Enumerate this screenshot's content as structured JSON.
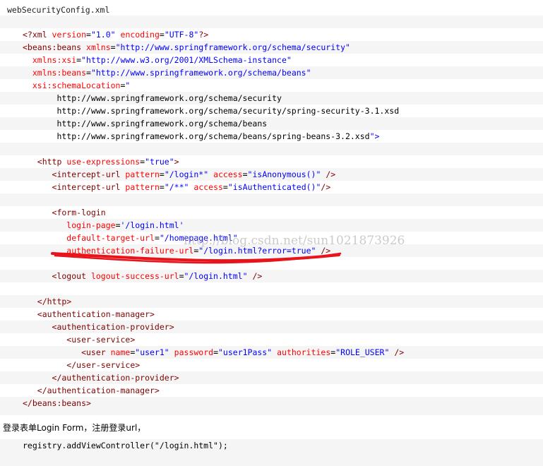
{
  "title": "webSecurityConfig.xml",
  "colors": {
    "tag": "#800000",
    "attr": "#ff0000",
    "value": "#0000ff",
    "text": "#000000",
    "annotation": "#e8141b"
  },
  "code_lines": [
    [],
    [
      {
        "t": "<?xml ",
        "c": "tag"
      },
      {
        "t": "version",
        "c": "attr"
      },
      {
        "t": "=",
        "c": "plain"
      },
      {
        "t": "\"1.0\"",
        "c": "val"
      },
      {
        "t": " ",
        "c": "plain"
      },
      {
        "t": "encoding",
        "c": "attr"
      },
      {
        "t": "=",
        "c": "plain"
      },
      {
        "t": "\"UTF-8\"",
        "c": "val"
      },
      {
        "t": "?>",
        "c": "tag"
      }
    ],
    [
      {
        "t": "<beans:beans ",
        "c": "tag"
      },
      {
        "t": "xmlns",
        "c": "attr"
      },
      {
        "t": "=",
        "c": "plain"
      },
      {
        "t": "\"http://www.springframework.org/schema/security\"",
        "c": "val"
      }
    ],
    [
      {
        "t": "  xmlns:xsi",
        "c": "attr"
      },
      {
        "t": "=",
        "c": "plain"
      },
      {
        "t": "\"http://www.w3.org/2001/XMLSchema-instance\"",
        "c": "val"
      }
    ],
    [
      {
        "t": "  xmlns:beans",
        "c": "attr"
      },
      {
        "t": "=",
        "c": "plain"
      },
      {
        "t": "\"http://www.springframework.org/schema/beans\"",
        "c": "val"
      }
    ],
    [
      {
        "t": "  xsi:schemaLocation",
        "c": "attr"
      },
      {
        "t": "=",
        "c": "plain"
      },
      {
        "t": "\"",
        "c": "val"
      }
    ],
    [
      {
        "t": "       http://www.springframework.org/schema/security",
        "c": "plain"
      }
    ],
    [
      {
        "t": "       http://www.springframework.org/schema/security/spring-security-3.1.xsd",
        "c": "plain"
      }
    ],
    [
      {
        "t": "       http://www.springframework.org/schema/beans",
        "c": "plain"
      }
    ],
    [
      {
        "t": "       http://www.springframework.org/schema/beans/spring-beans-3.2.xsd",
        "c": "plain"
      },
      {
        "t": "\">",
        "c": "val"
      }
    ],
    [],
    [
      {
        "t": "   <http ",
        "c": "tag"
      },
      {
        "t": "use-expressions",
        "c": "attr"
      },
      {
        "t": "=",
        "c": "plain"
      },
      {
        "t": "\"true\"",
        "c": "val"
      },
      {
        "t": ">",
        "c": "tag"
      }
    ],
    [
      {
        "t": "      <intercept-url ",
        "c": "tag"
      },
      {
        "t": "pattern",
        "c": "attr"
      },
      {
        "t": "=",
        "c": "plain"
      },
      {
        "t": "\"/login*\"",
        "c": "val"
      },
      {
        "t": " ",
        "c": "plain"
      },
      {
        "t": "access",
        "c": "attr"
      },
      {
        "t": "=",
        "c": "plain"
      },
      {
        "t": "\"isAnonymous()\"",
        "c": "val"
      },
      {
        "t": " />",
        "c": "tag"
      }
    ],
    [
      {
        "t": "      <intercept-url ",
        "c": "tag"
      },
      {
        "t": "pattern",
        "c": "attr"
      },
      {
        "t": "=",
        "c": "plain"
      },
      {
        "t": "\"/**\"",
        "c": "val"
      },
      {
        "t": " ",
        "c": "plain"
      },
      {
        "t": "access",
        "c": "attr"
      },
      {
        "t": "=",
        "c": "plain"
      },
      {
        "t": "\"isAuthenticated()\"",
        "c": "val"
      },
      {
        "t": "/>",
        "c": "tag"
      }
    ],
    [],
    [
      {
        "t": "      <form-login",
        "c": "tag"
      }
    ],
    [
      {
        "t": "         login-page",
        "c": "attr"
      },
      {
        "t": "=",
        "c": "plain"
      },
      {
        "t": "'/login.html'",
        "c": "val"
      }
    ],
    [
      {
        "t": "         default-target-url",
        "c": "attr"
      },
      {
        "t": "=",
        "c": "plain"
      },
      {
        "t": "\"/homepage.html\"",
        "c": "val"
      }
    ],
    [
      {
        "t": "         authentication-failure-url",
        "c": "attr"
      },
      {
        "t": "=",
        "c": "plain"
      },
      {
        "t": "\"/login.html?error=true\"",
        "c": "val"
      },
      {
        "t": " />",
        "c": "tag"
      }
    ],
    [],
    [
      {
        "t": "      <logout ",
        "c": "tag"
      },
      {
        "t": "logout-success-url",
        "c": "attr"
      },
      {
        "t": "=",
        "c": "plain"
      },
      {
        "t": "\"/login.html\"",
        "c": "val"
      },
      {
        "t": " />",
        "c": "tag"
      }
    ],
    [],
    [
      {
        "t": "   </http>",
        "c": "tag"
      }
    ],
    [
      {
        "t": "   <authentication-manager>",
        "c": "tag"
      }
    ],
    [
      {
        "t": "      <authentication-provider>",
        "c": "tag"
      }
    ],
    [
      {
        "t": "         <user-service>",
        "c": "tag"
      }
    ],
    [
      {
        "t": "            <user ",
        "c": "tag"
      },
      {
        "t": "name",
        "c": "attr"
      },
      {
        "t": "=",
        "c": "plain"
      },
      {
        "t": "\"user1\"",
        "c": "val"
      },
      {
        "t": " ",
        "c": "plain"
      },
      {
        "t": "password",
        "c": "attr"
      },
      {
        "t": "=",
        "c": "plain"
      },
      {
        "t": "\"user1Pass\"",
        "c": "val"
      },
      {
        "t": " ",
        "c": "plain"
      },
      {
        "t": "authorities",
        "c": "attr"
      },
      {
        "t": "=",
        "c": "plain"
      },
      {
        "t": "\"ROLE_USER\"",
        "c": "val"
      },
      {
        "t": " />",
        "c": "tag"
      }
    ],
    [
      {
        "t": "         </user-service>",
        "c": "tag"
      }
    ],
    [
      {
        "t": "      </authentication-provider>",
        "c": "tag"
      }
    ],
    [
      {
        "t": "   </authentication-manager>",
        "c": "tag"
      }
    ],
    [
      {
        "t": "</beans:beans>",
        "c": "tag"
      }
    ]
  ],
  "prose": "登录表单Login Form，注册登录url，",
  "code_lines_2": [
    [
      {
        "t": "registry.addViewController(\"/login.html\");",
        "c": "plain"
      }
    ]
  ],
  "watermark": "http://blog.csdn.net/sun1021873926"
}
